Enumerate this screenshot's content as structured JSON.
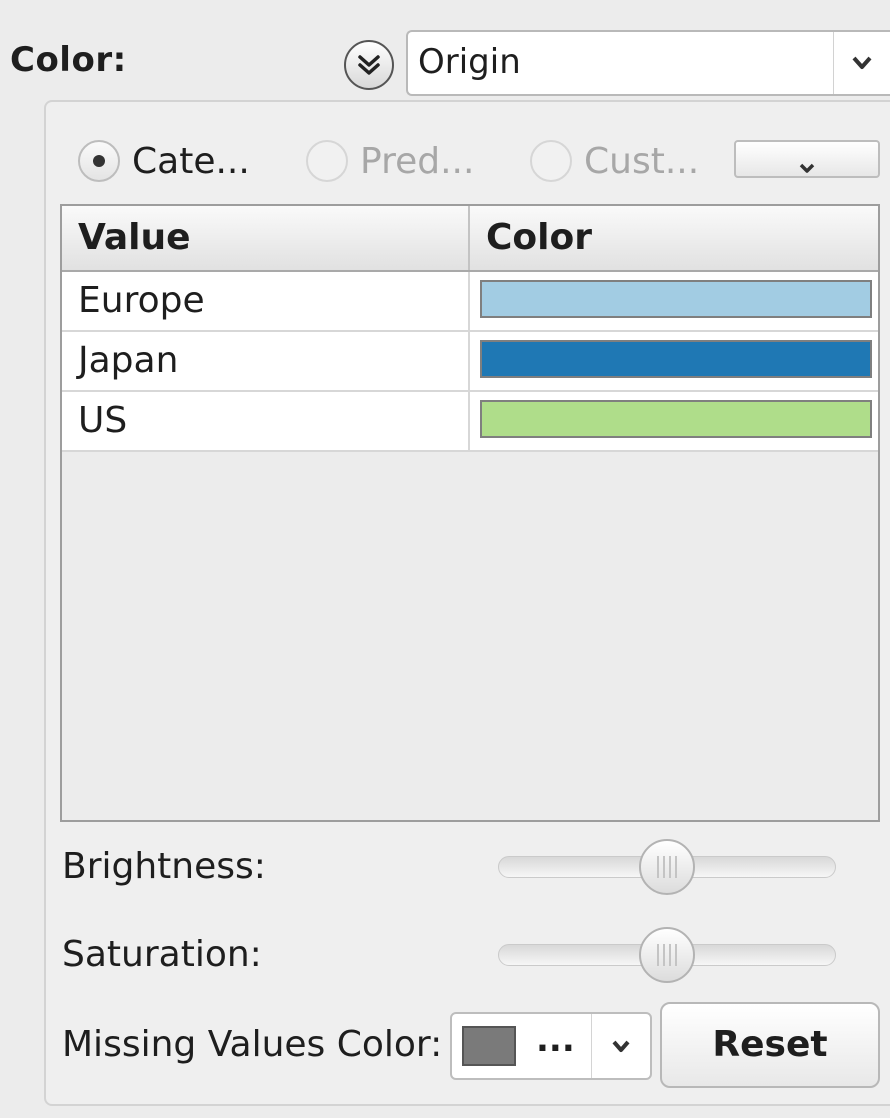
{
  "header": {
    "color_label": "Color:",
    "expand_icon": "double-chevron-down-icon",
    "column_select": {
      "value": "Origin"
    }
  },
  "mode": {
    "options": [
      {
        "label": "Cate...",
        "selected": true,
        "enabled": true
      },
      {
        "label": "Pred...",
        "selected": false,
        "enabled": false
      },
      {
        "label": "Cust...",
        "selected": false,
        "enabled": false
      }
    ]
  },
  "table": {
    "headers": [
      "Value",
      "Color"
    ],
    "rows": [
      {
        "value": "Europe",
        "color": "#a2cce3"
      },
      {
        "value": "Japan",
        "color": "#1f78b4"
      },
      {
        "value": "US",
        "color": "#afdd8a"
      }
    ]
  },
  "sliders": {
    "brightness": {
      "label": "Brightness:",
      "level": 0.5
    },
    "saturation": {
      "label": "Saturation:",
      "level": 0.5
    }
  },
  "missing": {
    "label": "Missing Values Color:",
    "swatch_color": "#7a7a7a",
    "ellipsis": "..."
  },
  "reset_label": "Reset"
}
